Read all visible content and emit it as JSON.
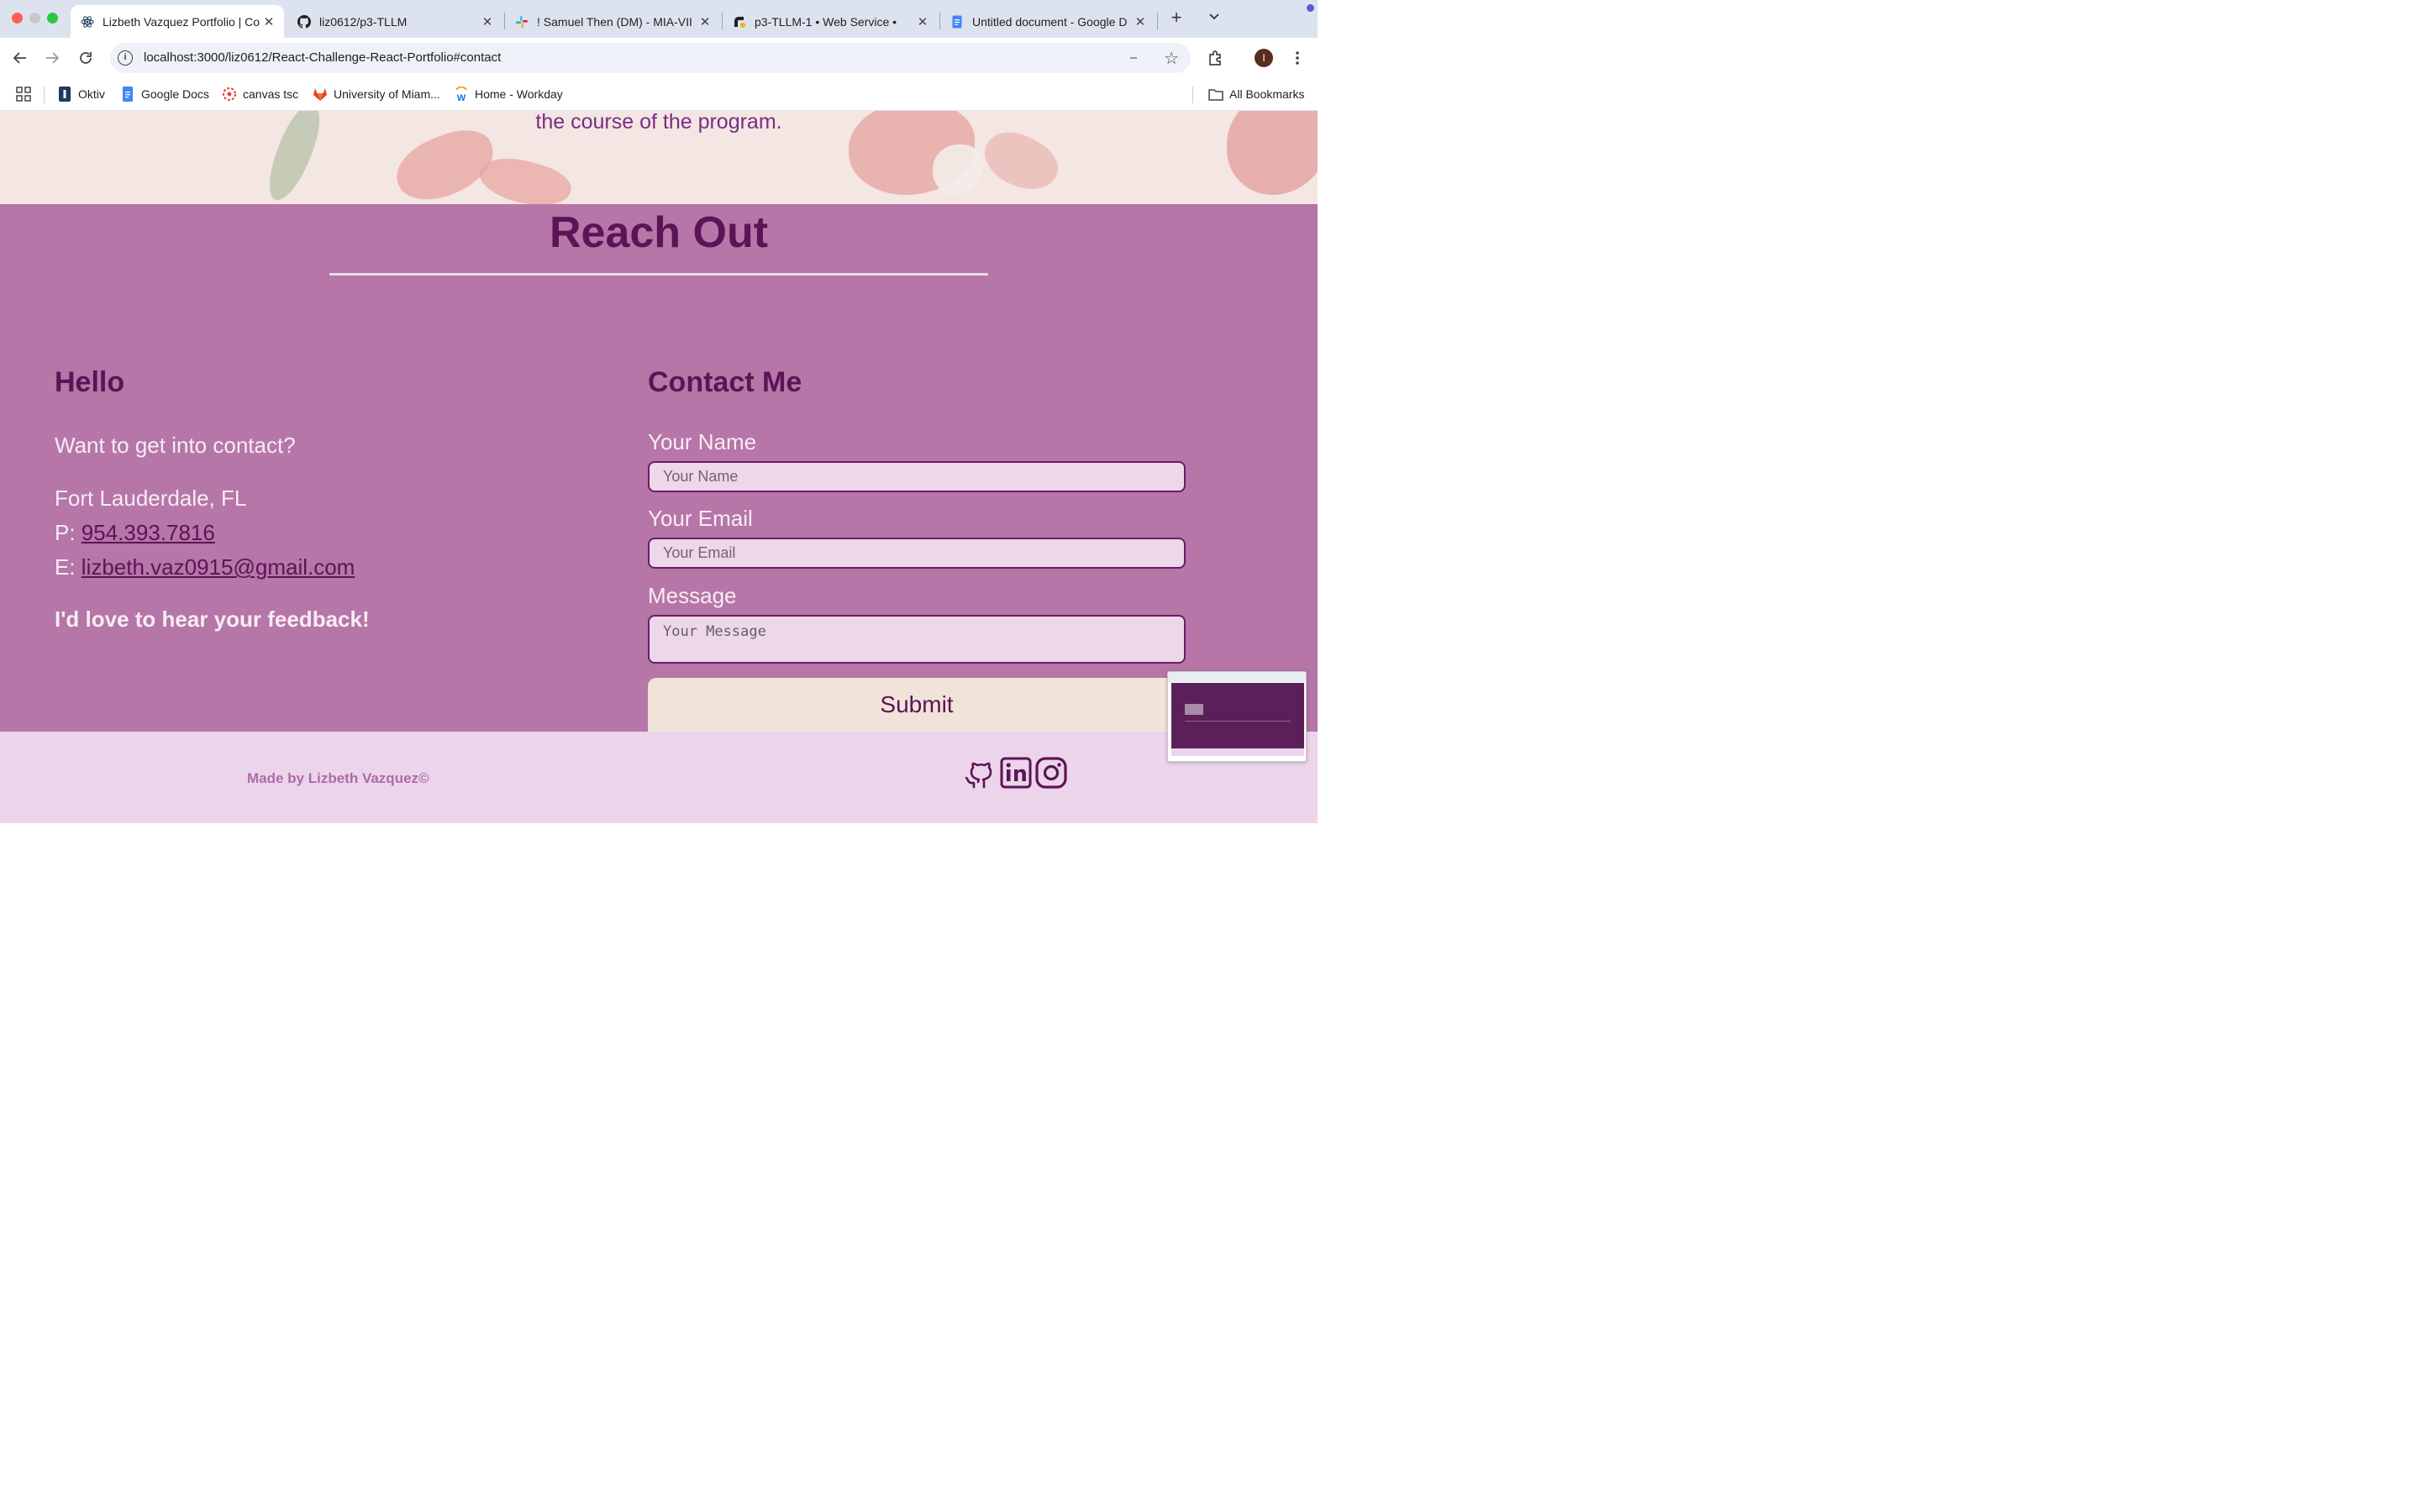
{
  "browser": {
    "tabs": [
      {
        "title": "Lizbeth Vazquez Portfolio | Co",
        "close": "✕",
        "active": true
      },
      {
        "title": "liz0612/p3-TLLM",
        "close": "✕",
        "active": false
      },
      {
        "title": "! Samuel Then (DM) - MIA-VII",
        "close": "✕",
        "active": false
      },
      {
        "title": "p3-TLLM-1 • Web Service •",
        "close": "✕",
        "active": false
      },
      {
        "title": "Untitled document - Google D",
        "close": "✕",
        "active": false
      }
    ],
    "new_tab": "+",
    "url_host": "localhost",
    "url_rest": ":3000/liz0612/React-Challenge-React-Portfolio#contact",
    "avatar_letter": "I",
    "bookmarks": [
      "Oktiv",
      "Google Docs",
      "canvas tsc",
      "University of Miam...",
      "Home - Workday"
    ],
    "all_bookmarks": "All Bookmarks"
  },
  "hero": {
    "text": "the course of the program."
  },
  "contact": {
    "title": "Reach Out",
    "left": {
      "heading": "Hello",
      "intro": "Want to get into contact?",
      "city": "Fort Lauderdale, FL",
      "phone_prefix": "P: ",
      "phone": "954.393.7816",
      "email_prefix": "E: ",
      "email": "lizbeth.vaz0915@gmail.com",
      "feedback": "I'd love to hear your feedback!"
    },
    "form": {
      "heading": "Contact Me",
      "name_label": "Your Name",
      "name_placeholder": "Your Name",
      "email_label": "Your Email",
      "email_placeholder": "Your Email",
      "message_label": "Message",
      "message_placeholder": "Your Message",
      "submit": "Submit"
    }
  },
  "footer": {
    "made_by": "Made by Lizbeth Vazquez©",
    "social": [
      "github-icon",
      "linkedin-icon",
      "instagram-icon"
    ]
  },
  "colors": {
    "contact_bg": "#b676a8",
    "heading": "#5b1455",
    "footer_bg": "#ecd4eb",
    "submit_bg": "#f1e3d9"
  }
}
